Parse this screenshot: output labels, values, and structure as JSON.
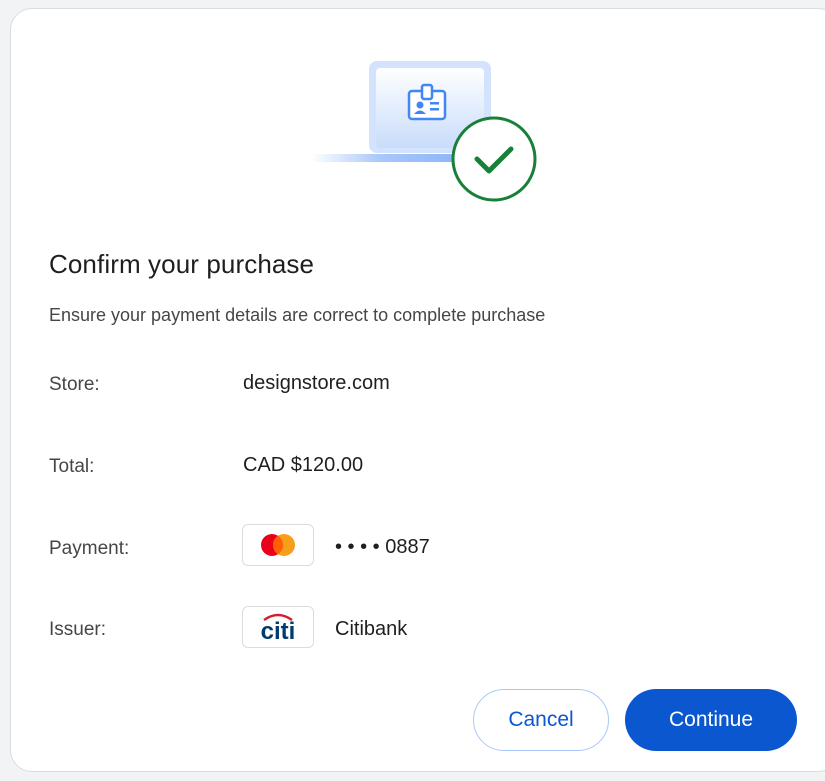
{
  "dialog": {
    "title": "Confirm your purchase",
    "description": "Ensure your payment details are correct to complete purchase",
    "hero_icon": "laptop-with-id-badge-and-checkmark",
    "success_color": "#188038"
  },
  "details": {
    "store": {
      "label": "Store:",
      "value": "designstore.com"
    },
    "total": {
      "label": "Total:",
      "value": "CAD $120.00"
    },
    "payment": {
      "label": "Payment:",
      "card_icon": "mastercard-logo",
      "value": "• • • • 0887"
    },
    "issuer": {
      "label": "Issuer:",
      "bank_icon": "citi-logo",
      "bank_logo_text": "citi",
      "value": "Citibank"
    }
  },
  "actions": {
    "cancel_label": "Cancel",
    "continue_label": "Continue",
    "primary_color": "#0b57d0"
  }
}
